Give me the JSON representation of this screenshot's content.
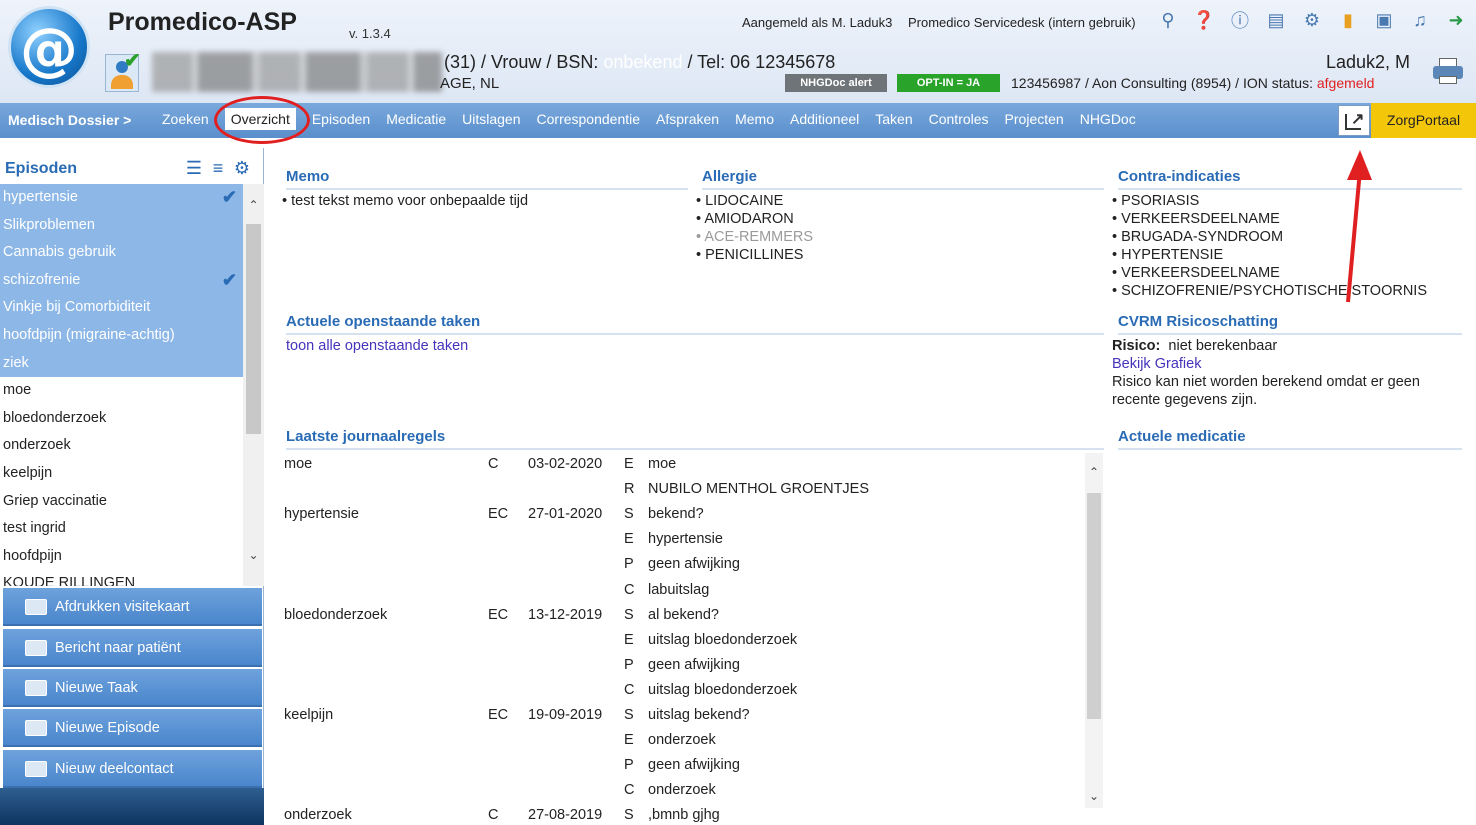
{
  "app": {
    "name": "Promedico-ASP",
    "version": "v. 1.3.4",
    "logged_in": "Aangemeld als M. Laduk3",
    "servicedesk": "Promedico Servicedesk (intern gebruik)"
  },
  "toolbar_icons": [
    "network-icon",
    "help-person-icon",
    "help-icon",
    "document-icon",
    "settings-icon",
    "folder-icon",
    "search-doc-icon",
    "notify-icon",
    "exit-icon"
  ],
  "patient": {
    "line1_prefix": "(31) / Vrouw / BSN: ",
    "bsn_value": "onbekend",
    "line1_suffix": " / Tel: 06 12345678",
    "line2": "AGE, NL",
    "nhgdoc_alert": "NHGDoc alert",
    "optin": "OPT-IN = JA",
    "ion_prefix": "123456987 / Aon Consulting (8954) / ION status: ",
    "ion_status": "afgemeld",
    "doctor": "Laduk2, M"
  },
  "nav": {
    "title": "Medisch Dossier >",
    "tabs": [
      {
        "label": "Zoeken",
        "active": false
      },
      {
        "label": "Overzicht",
        "active": true
      },
      {
        "label": "Episoden",
        "active": false
      },
      {
        "label": "Medicatie",
        "active": false
      },
      {
        "label": "Uitslagen",
        "active": false
      },
      {
        "label": "Correspondentie",
        "active": false
      },
      {
        "label": "Afspraken",
        "active": false
      },
      {
        "label": "Memo",
        "active": false
      },
      {
        "label": "Additioneel",
        "active": false
      },
      {
        "label": "Taken",
        "active": false
      },
      {
        "label": "Controles",
        "active": false
      },
      {
        "label": "Projecten",
        "active": false
      },
      {
        "label": "NHGDoc",
        "active": false
      }
    ],
    "zorgportaal": "ZorgPortaal"
  },
  "sidebar": {
    "title": "Episoden",
    "episodes": [
      {
        "label": "hypertensie",
        "selected": true,
        "checked": true
      },
      {
        "label": "Slikproblemen",
        "selected": true,
        "checked": false
      },
      {
        "label": "Cannabis gebruik",
        "selected": true,
        "checked": false
      },
      {
        "label": "schizofrenie",
        "selected": true,
        "checked": true
      },
      {
        "label": "Vinkje bij Comorbiditeit",
        "selected": true,
        "checked": false
      },
      {
        "label": "hoofdpijn (migraine-achtig)",
        "selected": true,
        "checked": false
      },
      {
        "label": "ziek",
        "selected": true,
        "checked": false
      },
      {
        "label": "moe",
        "selected": false,
        "checked": false
      },
      {
        "label": "bloedonderzoek",
        "selected": false,
        "checked": false
      },
      {
        "label": "onderzoek",
        "selected": false,
        "checked": false
      },
      {
        "label": "keelpijn",
        "selected": false,
        "checked": false
      },
      {
        "label": "Griep vaccinatie",
        "selected": false,
        "checked": false
      },
      {
        "label": "test ingrid",
        "selected": false,
        "checked": false
      },
      {
        "label": "hoofdpijn",
        "selected": false,
        "checked": false
      },
      {
        "label": "KOUDE RILLINGEN",
        "selected": false,
        "checked": false
      }
    ],
    "actions": [
      "Afdrukken visitekaart",
      "Bericht naar patiënt",
      "Nieuwe Taak",
      "Nieuwe Episode",
      "Nieuw deelcontact"
    ]
  },
  "memo": {
    "title": "Memo",
    "items": [
      "test tekst memo voor onbepaalde tijd"
    ]
  },
  "allergie": {
    "title": "Allergie",
    "items": [
      {
        "label": "LIDOCAINE",
        "muted": false
      },
      {
        "label": "AMIODARON",
        "muted": false
      },
      {
        "label": "ACE-REMMERS",
        "muted": true
      },
      {
        "label": "PENICILLINES",
        "muted": false
      }
    ]
  },
  "contra": {
    "title": "Contra-indicaties",
    "items": [
      "PSORIASIS",
      "VERKEERSDEELNAME",
      "BRUGADA-SYNDROOM",
      "HYPERTENSIE",
      "VERKEERSDEELNAME",
      "SCHIZOFRENIE/PSYCHOTISCHE STOORNIS"
    ]
  },
  "taken": {
    "title": "Actuele openstaande taken",
    "link": "toon alle openstaande taken"
  },
  "cvrm": {
    "title": "CVRM Risicoschatting",
    "risico_label": "Risico:",
    "risico_value": "niet berekenbaar",
    "link": "Bekijk Grafiek",
    "note": "Risico kan niet worden berekend omdat er geen recente gegevens zijn."
  },
  "medicatie": {
    "title": "Actuele medicatie"
  },
  "journaal": {
    "title": "Laatste journaalregels",
    "rows": [
      {
        "episode": "moe",
        "type": "C",
        "date": "03-02-2020",
        "code": "E",
        "text": "moe"
      },
      {
        "episode": "",
        "type": "",
        "date": "",
        "code": "R",
        "text": "NUBILO MENTHOL GROENTJES"
      },
      {
        "episode": "hypertensie",
        "type": "EC",
        "date": "27-01-2020",
        "code": "S",
        "text": "bekend?"
      },
      {
        "episode": "",
        "type": "",
        "date": "",
        "code": "E",
        "text": "hypertensie"
      },
      {
        "episode": "",
        "type": "",
        "date": "",
        "code": "P",
        "text": "geen afwijking"
      },
      {
        "episode": "",
        "type": "",
        "date": "",
        "code": "C",
        "text": "labuitslag"
      },
      {
        "episode": "bloedonderzoek",
        "type": "EC",
        "date": "13-12-2019",
        "code": "S",
        "text": "al bekend?"
      },
      {
        "episode": "",
        "type": "",
        "date": "",
        "code": "E",
        "text": "uitslag bloedonderzoek"
      },
      {
        "episode": "",
        "type": "",
        "date": "",
        "code": "P",
        "text": "geen afwijking"
      },
      {
        "episode": "",
        "type": "",
        "date": "",
        "code": "C",
        "text": "uitslag bloedonderzoek"
      },
      {
        "episode": "keelpijn",
        "type": "EC",
        "date": "19-09-2019",
        "code": "S",
        "text": "uitslag bekend?"
      },
      {
        "episode": "",
        "type": "",
        "date": "",
        "code": "E",
        "text": "onderzoek"
      },
      {
        "episode": "",
        "type": "",
        "date": "",
        "code": "P",
        "text": "geen afwijking"
      },
      {
        "episode": "",
        "type": "",
        "date": "",
        "code": "C",
        "text": "onderzoek"
      },
      {
        "episode": "onderzoek",
        "type": "C",
        "date": "27-08-2019",
        "code": "S",
        "text": ",bmnb gjhg"
      }
    ]
  },
  "colors": {
    "nav_blue": "#5a8fcc",
    "title_blue": "#2a6bb5",
    "zorgportaal_yellow": "#f4c60a",
    "alert_red": "#e02020",
    "optin_green": "#29a329"
  }
}
